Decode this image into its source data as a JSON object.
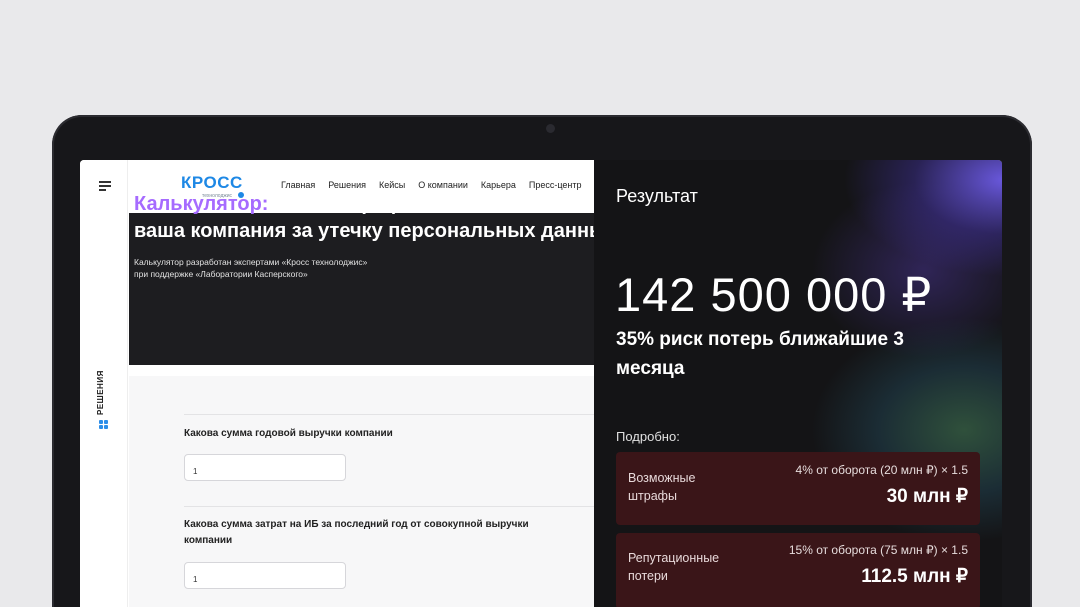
{
  "brand": {
    "name": "КРОСС",
    "tagline": "технолоджис"
  },
  "nav": {
    "items": [
      "Главная",
      "Решения",
      "Кейсы",
      "О компании",
      "Карьера",
      "Пресс-центр"
    ]
  },
  "sidebar": {
    "label": "РЕШЕНИЯ"
  },
  "hero": {
    "title_accent": "Калькулятор:",
    "title_line1_rest": " какой штраф заплатит",
    "title_line2": "ваша компания за утечку персональных данных",
    "desc_line1": "Калькулятор разработан экспертами «Кросс технолоджис»",
    "desc_line2": "при поддержке «Лаборатории Касперского»"
  },
  "form": {
    "q1": {
      "label": "Какова сумма годовой выручки компании",
      "value": "1"
    },
    "q2": {
      "label": "Какова сумма затрат на ИБ за последний год от совокупной выручки компании",
      "value": "1"
    }
  },
  "result": {
    "title": "Результат",
    "total": "142 500 000 ₽",
    "risk": "35% риск потерь ближайшие 3 месяца",
    "details_label": "Подробно:",
    "cards": [
      {
        "name_line1": "Возможные",
        "name_line2": "штрафы",
        "formula": "4% от оборота (20 млн ₽) × 1.5",
        "amount": "30 млн ₽"
      },
      {
        "name_line1": "Репутационные",
        "name_line2": "потери",
        "formula": "15% от оборота (75 млн ₽) × 1.5",
        "amount": "112.5 млн ₽"
      }
    ]
  },
  "colors": {
    "accent": "#a66bff",
    "brand": "#1e88e5",
    "card_bg": "#3a1518",
    "panel_bg": "#141416"
  }
}
